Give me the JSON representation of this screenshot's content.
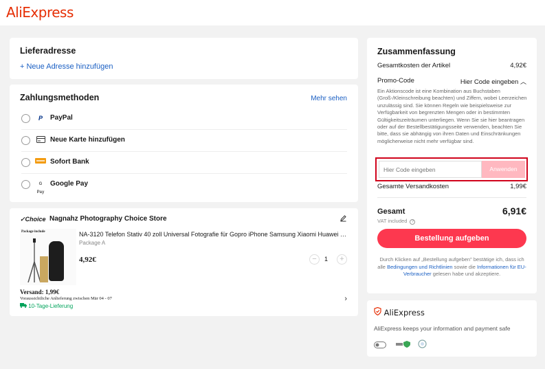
{
  "header": {
    "logo": "AliExpress"
  },
  "address": {
    "title": "Lieferadresse",
    "add_label": "+ Neue Adresse hinzufügen"
  },
  "payment": {
    "title": "Zahlungsmethoden",
    "more_label": "Mehr sehen",
    "methods": [
      {
        "label": "PayPal",
        "icon": "paypal-icon"
      },
      {
        "label": "Neue Karte hinzufügen",
        "icon": "card-icon"
      },
      {
        "label": "Sofort Bank",
        "icon": "sofort-icon"
      },
      {
        "label": "Google Pay",
        "icon": "gpay-icon",
        "icon_text": "G Pay"
      }
    ]
  },
  "store": {
    "choice_label": "✓Choice",
    "name": "Nagnahz Photography Choice Store",
    "product": {
      "image_caption": "Package include",
      "title": "NA-3120 Telefon Stativ 40 zoll Universal Fotografie für Gopro iPhone Samsung Xiaomi Huawei Handy Kamera Stativ",
      "variant": "Package A",
      "price": "4,92€",
      "quantity": "1",
      "shipping": "Versand: 1,99€",
      "estimated_delivery": "Voraussichtliche Anlieferung zwischen Mär 04 - 07",
      "delivery_badge": "10-Tage-Lieferung"
    }
  },
  "summary": {
    "title": "Zusammenfassung",
    "items_total_label": "Gesamtkosten der Artikel",
    "items_total_value": "4,92€",
    "promo_label": "Promo-Code",
    "promo_toggle": "Hier Code eingeben",
    "promo_info": "Ein Aktionscode ist eine Kombination aus Buchstaben (Groß-/Kleinschreibung beachten) und Ziffern, wobei Leerzeichen unzulässig sind. Sie können Regeln wie beispielsweise zur Verfügbarkeit von begrenzten Mengen oder in bestimmten Gültigkeitszeiträumen unterliegen. Wenn Sie sie hier beantragen oder auf der Bestellbestätigungsseite verwenden, beachten Sie bitte, dass sie abhängig von ihren Daten und Einschränkungen möglicherweise nicht mehr verfügbar sind.",
    "promo_placeholder": "Hier Code eingeben",
    "apply_label": "Anwenden",
    "shipping_label": "Gesamte Versandkosten",
    "shipping_value": "1,99€",
    "total_label": "Gesamt",
    "total_value": "6,91€",
    "vat_label": "VAT included",
    "order_button": "Bestellung aufgeben",
    "legal_prefix": "Durch Klicken auf „Bestellung aufgeben\" bestätige ich, dass ich alle ",
    "legal_link1": "Bedingungen und Richtlinien",
    "legal_mid": " sowie die ",
    "legal_link2": "Informationen für EU-Verbraucher",
    "legal_suffix": " gelesen habe und akzeptiere."
  },
  "trust": {
    "logo": "AliExpress",
    "text": "AliExpress keeps your information and payment safe"
  },
  "colors": {
    "brand": "#e62e04",
    "order_button": "#fd384f",
    "link": "#1a5fc3",
    "highlight": "#d0021b"
  }
}
